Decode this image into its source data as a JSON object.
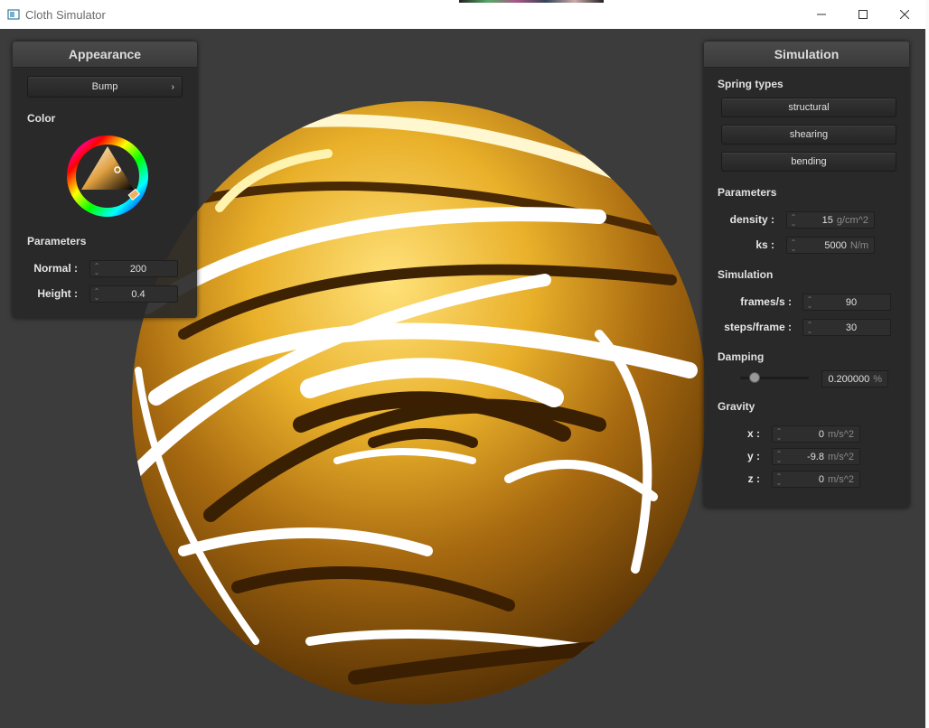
{
  "window": {
    "title": "Cloth Simulator"
  },
  "appearance": {
    "title": "Appearance",
    "shader_button": "Bump",
    "color_label": "Color",
    "params_label": "Parameters",
    "normal_label": "Normal :",
    "normal_value": "200",
    "height_label": "Height :",
    "height_value": "0.4"
  },
  "simulation": {
    "title": "Simulation",
    "spring_types_label": "Spring types",
    "springs": [
      "structural",
      "shearing",
      "bending"
    ],
    "params_label": "Parameters",
    "density_label": "density :",
    "density_value": "15",
    "density_unit": "g/cm^2",
    "ks_label": "ks :",
    "ks_value": "5000",
    "ks_unit": "N/m",
    "sim_label": "Simulation",
    "fps_label": "frames/s :",
    "fps_value": "90",
    "steps_label": "steps/frame :",
    "steps_value": "30",
    "damping_label": "Damping",
    "damping_fraction": 0.2,
    "damping_value": "0.200000",
    "damping_unit": "%",
    "gravity_label": "Gravity",
    "gx_label": "x :",
    "gx_value": "0",
    "gy_label": "y :",
    "gy_value": "-9.8",
    "gz_label": "z :",
    "gz_value": "0",
    "gravity_unit": "m/s^2"
  },
  "colors": {
    "viewport": "#3c3c3c",
    "panel": "#282828",
    "sphere_light": "#f3c02a",
    "sphere_dark": "#4a2c05"
  }
}
